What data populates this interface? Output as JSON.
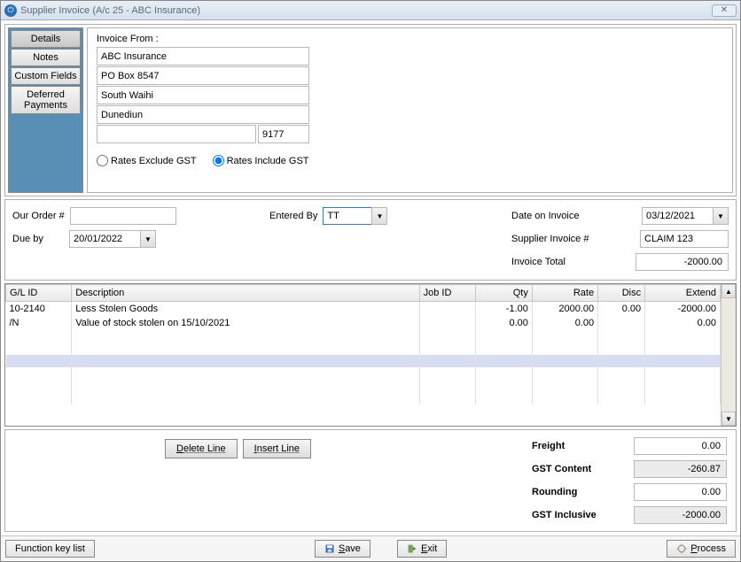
{
  "window": {
    "title": "Supplier Invoice (A/c 25 - ABC Insurance)"
  },
  "tabs": {
    "details": "Details",
    "notes": "Notes",
    "custom": "Custom Fields",
    "deferred1": "Deferred",
    "deferred2": "Payments"
  },
  "invoice_from": {
    "label": "Invoice From :",
    "line1": "ABC Insurance",
    "line2": "PO Box 8547",
    "line3": "South Waihi",
    "line4": "Dunediun",
    "line5": "",
    "zip": "9177"
  },
  "gst": {
    "exclude": "Rates Exclude GST",
    "include": "Rates Include GST"
  },
  "mid": {
    "our_order_label": "Our Order #",
    "our_order_value": "",
    "entered_by_label": "Entered By",
    "entered_by_value": "TT",
    "date_on_invoice_label": "Date on Invoice",
    "date_on_invoice_value": "03/12/2021",
    "due_by_label": "Due by",
    "due_by_value": "20/01/2022",
    "supplier_inv_label": "Supplier Invoice #",
    "supplier_inv_value": "CLAIM 123",
    "invoice_total_label": "Invoice Total",
    "invoice_total_value": "-2000.00"
  },
  "grid": {
    "headers": {
      "gl": "G/L ID",
      "desc": "Description",
      "job": "Job ID",
      "qty": "Qty",
      "rate": "Rate",
      "disc": "Disc",
      "ext": "Extend"
    },
    "rows": [
      {
        "gl": "10-2140",
        "desc": "Less Stolen Goods",
        "job": "",
        "qty": "-1.00",
        "rate": "2000.00",
        "disc": "0.00",
        "ext": "-2000.00"
      },
      {
        "gl": "/N",
        "desc": "Value of stock stolen on 15/10/2021",
        "job": "",
        "qty": "0.00",
        "rate": "0.00",
        "disc": "",
        "ext": "0.00"
      }
    ]
  },
  "actions": {
    "delete_line": "Delete Line",
    "insert_line": "Insert Line"
  },
  "totals": {
    "freight_label": "Freight",
    "freight_value": "0.00",
    "gst_content_label": "GST Content",
    "gst_content_value": "-260.87",
    "rounding_label": "Rounding",
    "rounding_value": "0.00",
    "gst_inclusive_label": "GST Inclusive",
    "gst_inclusive_value": "-2000.00"
  },
  "statusbar": {
    "fnkey": "Function key list",
    "save": "Save",
    "exit": "Exit",
    "process": "Process"
  }
}
